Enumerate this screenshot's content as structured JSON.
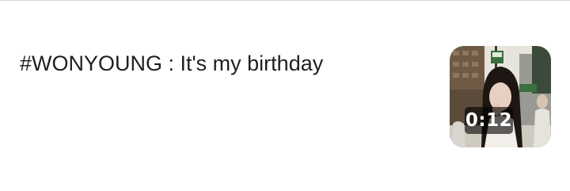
{
  "video": {
    "title": "#WONYOUNG : It's my birthday",
    "duration": "0:12",
    "thumbnail_icon": "video-thumbnail"
  },
  "colors": {
    "title_text": "#1f1f1f",
    "divider": "#d9d9d9",
    "duration_badge_bg": "#000000",
    "duration_text": "#ffffff"
  }
}
